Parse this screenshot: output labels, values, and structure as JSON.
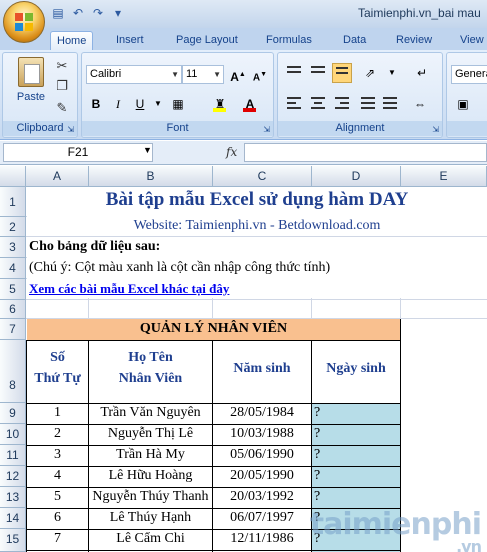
{
  "window": {
    "title": "Taimienphi.vn_bai mau"
  },
  "tabs": [
    "Home",
    "Insert",
    "Page Layout",
    "Formulas",
    "Data",
    "Review",
    "View"
  ],
  "ribbon": {
    "clipboard": {
      "paste": "Paste",
      "label": "Clipboard"
    },
    "font": {
      "name": "Calibri",
      "size": "11",
      "label": "Font",
      "bold": "B",
      "italic": "I",
      "underline": "U",
      "grow": "A",
      "shrink": "A",
      "font_color": "A"
    },
    "alignment": {
      "label": "Alignment"
    },
    "number": {
      "format": "General"
    }
  },
  "formula_bar": {
    "name_box": "F21",
    "fx": "fx",
    "value": ""
  },
  "columns": [
    "A",
    "B",
    "C",
    "D",
    "E"
  ],
  "rows": [
    "1",
    "2",
    "3",
    "4",
    "5",
    "6",
    "7",
    "8",
    "9",
    "10",
    "11",
    "12",
    "13",
    "14",
    "15"
  ],
  "sheet": {
    "title": "Bài tập mẫu Excel sử dụng hàm DAY",
    "website": "Website: Taimienphi.vn - Betdownload.com",
    "given": "Cho bảng dữ liệu sau:",
    "note": "(Chú ý: Cột màu xanh là cột cần nhập công thức tính)",
    "link": "Xem các bài mẫu Excel khác tại đây",
    "table_title": "QUẢN LÝ NHÂN VIÊN",
    "headers": {
      "stt_1": "Số",
      "stt_2": "Thứ Tự",
      "name_1": "Họ Tên",
      "name_2": "Nhân Viên",
      "birth_year": "Năm sinh",
      "birth_day": "Ngày sinh"
    },
    "rows": [
      {
        "stt": "1",
        "name": "Trần Văn Nguyên",
        "dob": "28/05/1984",
        "day": "?"
      },
      {
        "stt": "2",
        "name": "Nguyễn Thị Lê",
        "dob": "10/03/1988",
        "day": "?"
      },
      {
        "stt": "3",
        "name": "Trần Hà My",
        "dob": "05/06/1990",
        "day": "?"
      },
      {
        "stt": "4",
        "name": "Lê Hữu Hoàng",
        "dob": "20/05/1990",
        "day": "?"
      },
      {
        "stt": "5",
        "name": "Nguyễn Thúy Thanh",
        "dob": "20/03/1992",
        "day": "?"
      },
      {
        "stt": "6",
        "name": "Lê Thúy Hạnh",
        "dob": "06/07/1997",
        "day": "?"
      },
      {
        "stt": "7",
        "name": "Lê Cẩm Chi",
        "dob": "12/11/1986",
        "day": "?"
      }
    ]
  },
  "watermark": {
    "main": "taimienphi",
    "sub": ".vn"
  },
  "colors": {
    "table_header_bg": "#f9c08f",
    "formula_column_bg": "#b7dde8",
    "title_color": "#1f3f8f"
  }
}
